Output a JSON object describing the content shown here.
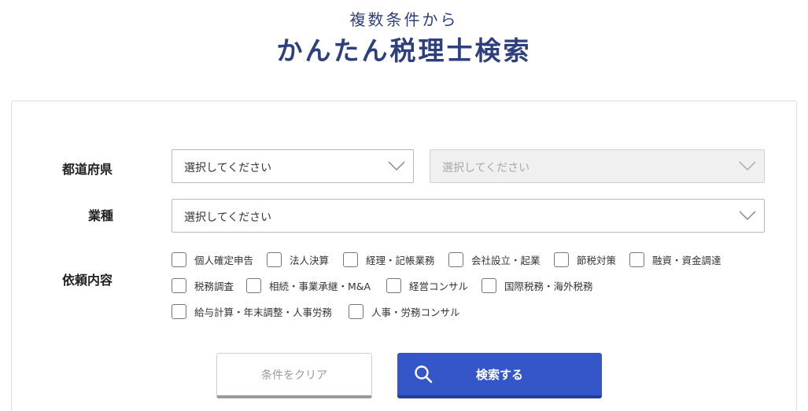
{
  "hero": {
    "subtitle": "複数条件から",
    "title": "かんたん税理士検索"
  },
  "form": {
    "prefecture": {
      "label": "都道府県",
      "select1_value": "選択してください",
      "select2_value": "選択してください"
    },
    "industry": {
      "label": "業種",
      "select_value": "選択してください"
    },
    "request": {
      "label": "依頼内容",
      "options": [
        "個人確定申告",
        "法人決算",
        "経理・記帳業務",
        "会社設立・起業",
        "節税対策",
        "融資・資金調達",
        "税務調査",
        "相続・事業承継・M&A",
        "経営コンサル",
        "国際税務・海外税務",
        "給与計算・年末調整・人事労務",
        "人事・労務コンサル"
      ]
    },
    "buttons": {
      "clear_label": "条件をクリア",
      "search_label": "検索する"
    }
  },
  "colors": {
    "title": "#2d3f7c",
    "primary": "#3556c8"
  }
}
